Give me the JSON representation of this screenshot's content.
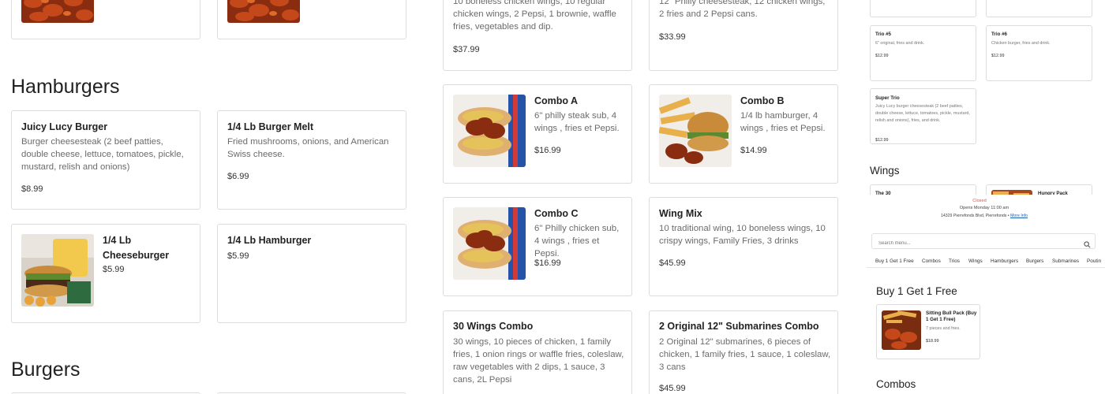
{
  "left_column": {
    "section_hamburgers": "Hamburgers",
    "section_burgers": "Burgers",
    "items": [
      {
        "name": "Juicy Lucy Burger",
        "desc": "Burger cheesesteak (2 beef patties, double cheese, lettuce, tomatoes, pickle, mustard, relish and onions)",
        "price": "$8.99"
      },
      {
        "name": "1/4 Lb Burger Melt",
        "desc": "Fried mushrooms, onions, and American Swiss cheese.",
        "price": "$6.99"
      },
      {
        "name": "1/4 Lb Cheeseburger",
        "desc": "",
        "price": "$5.99"
      },
      {
        "name": "1/4 Lb Hamburger",
        "desc": "",
        "price": "$5.99"
      }
    ]
  },
  "middle_column": {
    "top_items": [
      {
        "desc": "10 boneless chicken wings, 10 regular chicken wings, 2 Pepsi, 1 brownie, waffle fries, vegetables and dip.",
        "price": "$37.99"
      },
      {
        "desc": "12\" Philly cheesesteak, 12 chicken wings, 2 fries and 2 Pepsi cans.",
        "price": "$33.99"
      }
    ],
    "items": [
      {
        "name": "Combo A",
        "desc": "6\" philly steak sub, 4 wings , fries et Pepsi.",
        "price": "$16.99"
      },
      {
        "name": "Combo B",
        "desc": "1/4 lb hamburger, 4 wings , fries et Pepsi.",
        "price": "$14.99"
      },
      {
        "name": "Combo C",
        "desc": "6\" Philly chicken sub, 4 wings , fries et Pepsi.",
        "price": "$16.99"
      },
      {
        "name": "Wing Mix",
        "desc": "10 traditional wing, 10 boneless wings, 10 crispy wings, Family Fries, 3 drinks",
        "price": "$45.99"
      },
      {
        "name": "30 Wings Combo",
        "desc": "30 wings, 10 pieces of chicken, 1 family fries, 1 onion rings or waffle fries, coleslaw, raw vegetables with 2 dips, 1 sauce, 3 cans, 2L Pepsi",
        "price": ""
      },
      {
        "name": "2 Original 12\" Submarines Combo",
        "desc": "2 Original 12\" submarines, 6 pieces of chicken, 1 family fries, 1 sauce, 1 coleslaw, 3 cans",
        "price": "$45.99"
      }
    ]
  },
  "right_panel": {
    "trios": [
      {
        "name": "Trio #5",
        "desc": "6\" original, fries and drink.",
        "price": "$12.99"
      },
      {
        "name": "Trio #6",
        "desc": "Chicken burger, fries and drink.",
        "price": "$12.99"
      },
      {
        "name": "Super Trio",
        "desc": "Juicy Lucy burger cheesesteak (2 beef patties, double cheese, lettuce, tomatoes, pickle, mustard, relish and onions), fries, and drink.",
        "price": "$12.99"
      }
    ],
    "wings_title": "Wings",
    "wings_cards": [
      {
        "name": "The 30"
      },
      {
        "name": "Hungry Pack"
      }
    ],
    "status": "Closed",
    "opens": "Opens Monday 11:00 am",
    "address": "14329 Pierrefonds Blvd, Pierrefonds •",
    "more_info": "More Info",
    "search_placeholder": "Search menu...",
    "nav": [
      "Buy 1 Get 1 Free",
      "Combos",
      "Trios",
      "Wings",
      "Hamburgers",
      "Burgers",
      "Submarines",
      "Poutin"
    ],
    "bogo_title": "Buy 1 Get 1 Free",
    "bogo_item": {
      "name": "Sitting Bull Pack (Buy 1 Get 1 Free)",
      "desc": "7 pieces and fries.",
      "price": "$18.99"
    },
    "combos_title": "Combos",
    "colors": {
      "status_red": "#d9534f",
      "link_blue": "#1a5fb4"
    }
  }
}
